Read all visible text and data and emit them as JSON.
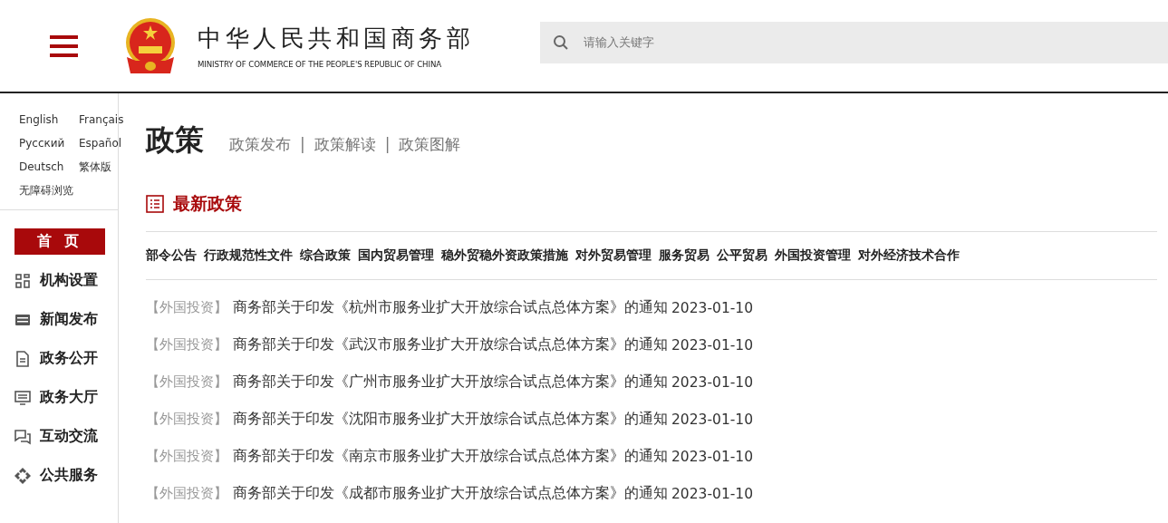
{
  "header": {
    "title": "中华人民共和国商务部",
    "subtitle": "MINISTRY OF COMMERCE OF THE PEOPLE'S REPUBLIC OF CHINA",
    "search": {
      "placeholder": "请输入关键字"
    }
  },
  "sidebar": {
    "languages": [
      "English",
      "Français",
      "Русский",
      "Español",
      "Deutsch",
      "繁体版",
      "无障碍浏览"
    ],
    "nav": [
      {
        "label": "首 页",
        "selected": true
      },
      {
        "label": "机构设置",
        "selected": false
      },
      {
        "label": "新闻发布",
        "selected": false
      },
      {
        "label": "政务公开",
        "selected": false
      },
      {
        "label": "政务大厅",
        "selected": false
      },
      {
        "label": "互动交流",
        "selected": false
      },
      {
        "label": "公共服务",
        "selected": false
      }
    ]
  },
  "page": {
    "title": "政策",
    "links": [
      "政策发布",
      "政策解读",
      "政策图解"
    ],
    "separator": "|"
  },
  "section": {
    "title": "最新政策",
    "categories": [
      "部令公告",
      "行政规范性文件",
      "综合政策",
      "国内贸易管理",
      "稳外贸稳外资政策措施",
      "对外贸易管理",
      "服务贸易",
      "公平贸易",
      "外国投资管理",
      "对外经济技术合作"
    ],
    "items": [
      {
        "tag": "【外国投资】",
        "title": "商务部关于印发《杭州市服务业扩大开放综合试点总体方案》的通知",
        "date": "2023-01-10"
      },
      {
        "tag": "【外国投资】",
        "title": "商务部关于印发《武汉市服务业扩大开放综合试点总体方案》的通知",
        "date": "2023-01-10"
      },
      {
        "tag": "【外国投资】",
        "title": "商务部关于印发《广州市服务业扩大开放综合试点总体方案》的通知",
        "date": "2023-01-10"
      },
      {
        "tag": "【外国投资】",
        "title": "商务部关于印发《沈阳市服务业扩大开放综合试点总体方案》的通知",
        "date": "2023-01-10"
      },
      {
        "tag": "【外国投资】",
        "title": "商务部关于印发《南京市服务业扩大开放综合试点总体方案》的通知",
        "date": "2023-01-10"
      },
      {
        "tag": "【外国投资】",
        "title": "商务部关于印发《成都市服务业扩大开放综合试点总体方案》的通知",
        "date": "2023-01-10"
      }
    ]
  }
}
